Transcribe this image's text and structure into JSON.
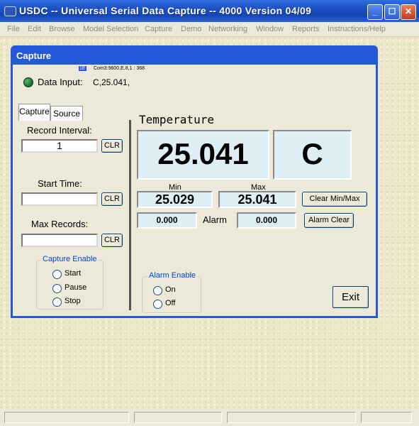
{
  "window": {
    "title": "USDC -- Universal Serial Data Capture -- 4000   Version 04/09"
  },
  "menu": [
    "File",
    "Edit",
    "Browse",
    "Model Selection",
    "Capture",
    "Demo",
    "Networking",
    "Window",
    "Reports",
    "Instructions/Help"
  ],
  "capture_window": {
    "title": "Capture",
    "port_badge": "1E",
    "com_settings": "Com3:9600,E,8,1 : 368",
    "data_input_label": "Data Input:",
    "data_input_value": "C,25.041,",
    "tabs": [
      "Capture",
      "Source"
    ],
    "record_interval": {
      "label": "Record Interval:",
      "value": "1",
      "clr": "CLR"
    },
    "start_time": {
      "label": "Start Time:",
      "value": "",
      "clr": "CLR"
    },
    "max_records": {
      "label": "Max Records:",
      "value": "",
      "clr": "CLR"
    },
    "capture_enable": {
      "title": "Capture Enable",
      "options": [
        "Start",
        "Pause",
        "Stop"
      ]
    },
    "reading": {
      "label": "Temperature",
      "value": "25.041",
      "unit": "C",
      "min_label": "Min",
      "min_value": "25.029",
      "max_label": "Max",
      "max_value": "25.041",
      "clear_minmax": "Clear Min/Max",
      "alarm_label": "Alarm",
      "alarm_low": "0.000",
      "alarm_high": "0.000",
      "alarm_clear": "Alarm Clear"
    },
    "alarm_enable": {
      "title": "Alarm Enable",
      "options": [
        "On",
        "Off"
      ]
    },
    "exit_label": "Exit"
  },
  "colors": {
    "titlebar": "#1c4fc4",
    "display_bg": "#ddeff4",
    "group_title": "#0046d5"
  }
}
